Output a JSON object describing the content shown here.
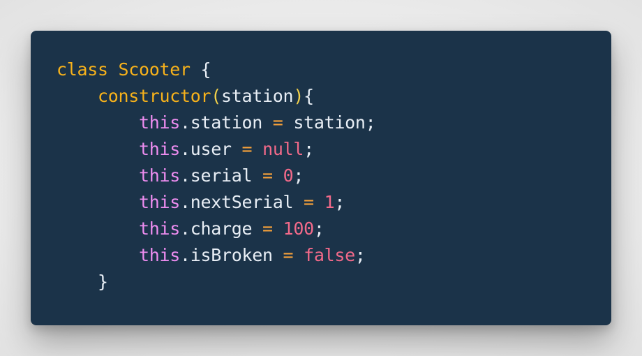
{
  "code": {
    "lines": [
      {
        "indent": "",
        "tokens": [
          {
            "text": "class",
            "type": "kw"
          },
          {
            "text": " ",
            "type": "plain"
          },
          {
            "text": "Scooter",
            "type": "cls"
          },
          {
            "text": " {",
            "type": "plain"
          }
        ]
      },
      {
        "indent": "    ",
        "tokens": [
          {
            "text": "constructor",
            "type": "fn"
          },
          {
            "text": "(",
            "type": "paren"
          },
          {
            "text": "station",
            "type": "plain"
          },
          {
            "text": ")",
            "type": "paren"
          },
          {
            "text": "{",
            "type": "plain"
          }
        ]
      },
      {
        "indent": "        ",
        "tokens": [
          {
            "text": "this",
            "type": "this"
          },
          {
            "text": ".station ",
            "type": "plain"
          },
          {
            "text": "=",
            "type": "op"
          },
          {
            "text": " station;",
            "type": "plain"
          }
        ]
      },
      {
        "indent": "        ",
        "tokens": [
          {
            "text": "this",
            "type": "this"
          },
          {
            "text": ".user ",
            "type": "plain"
          },
          {
            "text": "=",
            "type": "op"
          },
          {
            "text": " ",
            "type": "plain"
          },
          {
            "text": "null",
            "type": "lit"
          },
          {
            "text": ";",
            "type": "plain"
          }
        ]
      },
      {
        "indent": "        ",
        "tokens": [
          {
            "text": "this",
            "type": "this"
          },
          {
            "text": ".serial ",
            "type": "plain"
          },
          {
            "text": "=",
            "type": "op"
          },
          {
            "text": " ",
            "type": "plain"
          },
          {
            "text": "0",
            "type": "num"
          },
          {
            "text": ";",
            "type": "plain"
          }
        ]
      },
      {
        "indent": "        ",
        "tokens": [
          {
            "text": "this",
            "type": "this"
          },
          {
            "text": ".nextSerial ",
            "type": "plain"
          },
          {
            "text": "=",
            "type": "op"
          },
          {
            "text": " ",
            "type": "plain"
          },
          {
            "text": "1",
            "type": "num"
          },
          {
            "text": ";",
            "type": "plain"
          }
        ]
      },
      {
        "indent": "        ",
        "tokens": [
          {
            "text": "this",
            "type": "this"
          },
          {
            "text": ".charge ",
            "type": "plain"
          },
          {
            "text": "=",
            "type": "op"
          },
          {
            "text": " ",
            "type": "plain"
          },
          {
            "text": "100",
            "type": "num"
          },
          {
            "text": ";",
            "type": "plain"
          }
        ]
      },
      {
        "indent": "        ",
        "tokens": [
          {
            "text": "this",
            "type": "this"
          },
          {
            "text": ".isBroken ",
            "type": "plain"
          },
          {
            "text": "=",
            "type": "op"
          },
          {
            "text": " ",
            "type": "plain"
          },
          {
            "text": "false",
            "type": "lit"
          },
          {
            "text": ";",
            "type": "plain"
          }
        ]
      },
      {
        "indent": "    ",
        "tokens": [
          {
            "text": "}",
            "type": "plain"
          }
        ]
      }
    ]
  },
  "theme": {
    "card_background": "#1b3349",
    "page_background": "#ececec",
    "keyword_color": "#f7b21b",
    "this_color": "#ee8df0",
    "operator_color": "#f7a23a",
    "literal_color": "#f36a8a",
    "text_color": "#e8eef5"
  }
}
